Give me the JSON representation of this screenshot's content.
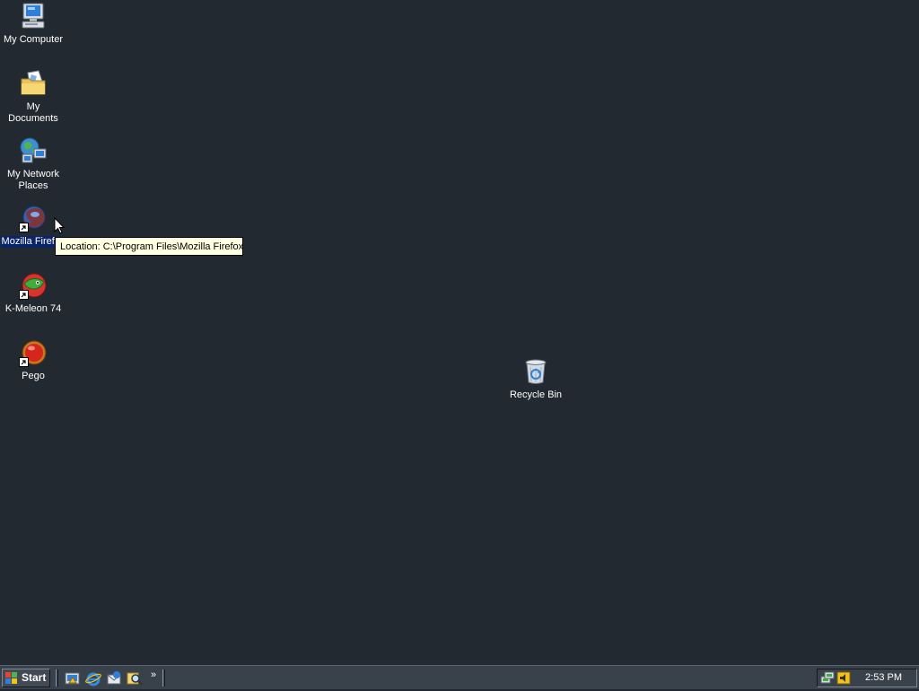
{
  "desktop": {
    "icons": [
      {
        "label": "My Computer",
        "icon": "computer-icon"
      },
      {
        "label": "My Documents",
        "icon": "folder-icon"
      },
      {
        "label": "My Network\nPlaces",
        "icon": "network-icon"
      },
      {
        "label": "Mozilla Firefox",
        "icon": "firefox-icon",
        "shortcut": true,
        "selected": true
      },
      {
        "label": "K-Meleon 74",
        "icon": "kmeleon-icon",
        "shortcut": true
      },
      {
        "label": "Pego",
        "icon": "pego-icon",
        "shortcut": true
      },
      {
        "label": "Recycle Bin",
        "icon": "recycle-bin-icon"
      }
    ],
    "tooltip": "Location: C:\\Program Files\\Mozilla Firefox"
  },
  "taskbar": {
    "start_label": "Start",
    "quick_launch": [
      "show-desktop-icon",
      "internet-explorer-icon",
      "outlook-express-icon",
      "search-icon"
    ],
    "chevron": "»",
    "tray_icons": [
      "network-connection-icon",
      "volume-icon"
    ],
    "clock": "2:53 PM"
  },
  "colors": {
    "desktop_background": "#232930",
    "taskbar": "#39414b",
    "selection": "#0a246a",
    "tooltip_background": "#ffffe1"
  }
}
